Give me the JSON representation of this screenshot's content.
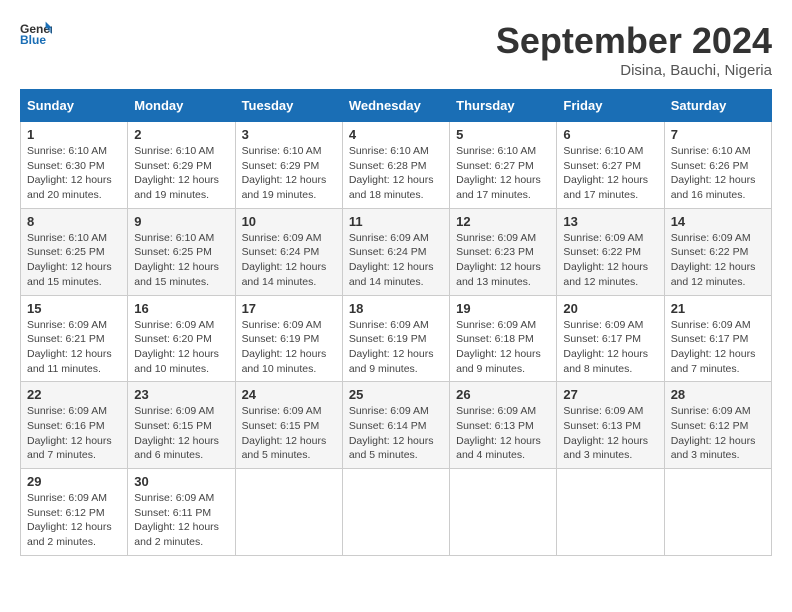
{
  "logo": {
    "line1": "General",
    "line2": "Blue"
  },
  "title": "September 2024",
  "subtitle": "Disina, Bauchi, Nigeria",
  "days_of_week": [
    "Sunday",
    "Monday",
    "Tuesday",
    "Wednesday",
    "Thursday",
    "Friday",
    "Saturday"
  ],
  "weeks": [
    [
      {
        "day": "1",
        "info": "Sunrise: 6:10 AM\nSunset: 6:30 PM\nDaylight: 12 hours\nand 20 minutes."
      },
      {
        "day": "2",
        "info": "Sunrise: 6:10 AM\nSunset: 6:29 PM\nDaylight: 12 hours\nand 19 minutes."
      },
      {
        "day": "3",
        "info": "Sunrise: 6:10 AM\nSunset: 6:29 PM\nDaylight: 12 hours\nand 19 minutes."
      },
      {
        "day": "4",
        "info": "Sunrise: 6:10 AM\nSunset: 6:28 PM\nDaylight: 12 hours\nand 18 minutes."
      },
      {
        "day": "5",
        "info": "Sunrise: 6:10 AM\nSunset: 6:27 PM\nDaylight: 12 hours\nand 17 minutes."
      },
      {
        "day": "6",
        "info": "Sunrise: 6:10 AM\nSunset: 6:27 PM\nDaylight: 12 hours\nand 17 minutes."
      },
      {
        "day": "7",
        "info": "Sunrise: 6:10 AM\nSunset: 6:26 PM\nDaylight: 12 hours\nand 16 minutes."
      }
    ],
    [
      {
        "day": "8",
        "info": "Sunrise: 6:10 AM\nSunset: 6:25 PM\nDaylight: 12 hours\nand 15 minutes."
      },
      {
        "day": "9",
        "info": "Sunrise: 6:10 AM\nSunset: 6:25 PM\nDaylight: 12 hours\nand 15 minutes."
      },
      {
        "day": "10",
        "info": "Sunrise: 6:09 AM\nSunset: 6:24 PM\nDaylight: 12 hours\nand 14 minutes."
      },
      {
        "day": "11",
        "info": "Sunrise: 6:09 AM\nSunset: 6:24 PM\nDaylight: 12 hours\nand 14 minutes."
      },
      {
        "day": "12",
        "info": "Sunrise: 6:09 AM\nSunset: 6:23 PM\nDaylight: 12 hours\nand 13 minutes."
      },
      {
        "day": "13",
        "info": "Sunrise: 6:09 AM\nSunset: 6:22 PM\nDaylight: 12 hours\nand 12 minutes."
      },
      {
        "day": "14",
        "info": "Sunrise: 6:09 AM\nSunset: 6:22 PM\nDaylight: 12 hours\nand 12 minutes."
      }
    ],
    [
      {
        "day": "15",
        "info": "Sunrise: 6:09 AM\nSunset: 6:21 PM\nDaylight: 12 hours\nand 11 minutes."
      },
      {
        "day": "16",
        "info": "Sunrise: 6:09 AM\nSunset: 6:20 PM\nDaylight: 12 hours\nand 10 minutes."
      },
      {
        "day": "17",
        "info": "Sunrise: 6:09 AM\nSunset: 6:19 PM\nDaylight: 12 hours\nand 10 minutes."
      },
      {
        "day": "18",
        "info": "Sunrise: 6:09 AM\nSunset: 6:19 PM\nDaylight: 12 hours\nand 9 minutes."
      },
      {
        "day": "19",
        "info": "Sunrise: 6:09 AM\nSunset: 6:18 PM\nDaylight: 12 hours\nand 9 minutes."
      },
      {
        "day": "20",
        "info": "Sunrise: 6:09 AM\nSunset: 6:17 PM\nDaylight: 12 hours\nand 8 minutes."
      },
      {
        "day": "21",
        "info": "Sunrise: 6:09 AM\nSunset: 6:17 PM\nDaylight: 12 hours\nand 7 minutes."
      }
    ],
    [
      {
        "day": "22",
        "info": "Sunrise: 6:09 AM\nSunset: 6:16 PM\nDaylight: 12 hours\nand 7 minutes."
      },
      {
        "day": "23",
        "info": "Sunrise: 6:09 AM\nSunset: 6:15 PM\nDaylight: 12 hours\nand 6 minutes."
      },
      {
        "day": "24",
        "info": "Sunrise: 6:09 AM\nSunset: 6:15 PM\nDaylight: 12 hours\nand 5 minutes."
      },
      {
        "day": "25",
        "info": "Sunrise: 6:09 AM\nSunset: 6:14 PM\nDaylight: 12 hours\nand 5 minutes."
      },
      {
        "day": "26",
        "info": "Sunrise: 6:09 AM\nSunset: 6:13 PM\nDaylight: 12 hours\nand 4 minutes."
      },
      {
        "day": "27",
        "info": "Sunrise: 6:09 AM\nSunset: 6:13 PM\nDaylight: 12 hours\nand 3 minutes."
      },
      {
        "day": "28",
        "info": "Sunrise: 6:09 AM\nSunset: 6:12 PM\nDaylight: 12 hours\nand 3 minutes."
      }
    ],
    [
      {
        "day": "29",
        "info": "Sunrise: 6:09 AM\nSunset: 6:12 PM\nDaylight: 12 hours\nand 2 minutes."
      },
      {
        "day": "30",
        "info": "Sunrise: 6:09 AM\nSunset: 6:11 PM\nDaylight: 12 hours\nand 2 minutes."
      },
      {
        "day": "",
        "info": ""
      },
      {
        "day": "",
        "info": ""
      },
      {
        "day": "",
        "info": ""
      },
      {
        "day": "",
        "info": ""
      },
      {
        "day": "",
        "info": ""
      }
    ]
  ]
}
